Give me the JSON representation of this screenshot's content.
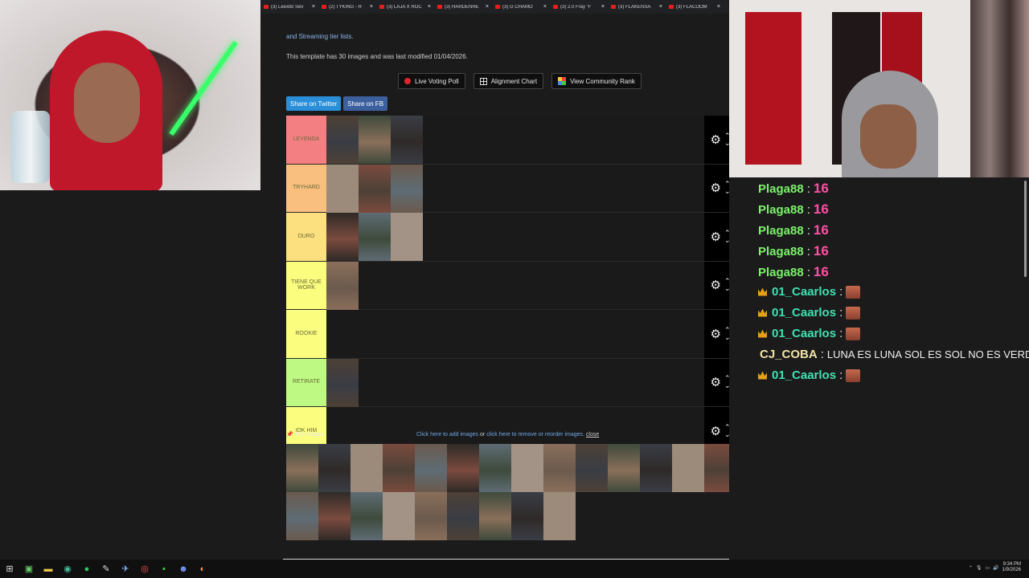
{
  "browser": {
    "tabs": [
      {
        "title": "(3) Leexito Sev",
        "close": "×"
      },
      {
        "title": "(2) TYKING - R",
        "close": "×"
      },
      {
        "title": "(3) LAJA X ROC",
        "close": "×"
      },
      {
        "title": "(3) HARDENRE",
        "close": "×"
      },
      {
        "title": "(3) G CHAMO",
        "close": "×"
      },
      {
        "title": "(3) 2.0 Fray \"F",
        "close": "×"
      },
      {
        "title": "(3) FLAKENSA",
        "close": "×"
      },
      {
        "title": "(3) FLACOOM",
        "close": "×"
      }
    ]
  },
  "page": {
    "streaming_link": "and Streaming tier lists.",
    "template_info": "This template has 30 images and was last modified 01/04/2026.",
    "buttons": {
      "live_poll": "Live Voting Poll",
      "alignment": "Alignment Chart",
      "community": "View Community Rank"
    },
    "share": {
      "twitter": "Share on Twitter",
      "facebook": "Share on FB"
    },
    "tiers": [
      {
        "label": "LEYENDA",
        "color": "#f47f82",
        "count": 3
      },
      {
        "label": "TRYHARD",
        "color": "#f8bf7f",
        "count": 3
      },
      {
        "label": "DURO",
        "color": "#fcdf7f",
        "count": 3
      },
      {
        "label": "TIENE QUE WORK",
        "color": "#fbfd7f",
        "count": 1
      },
      {
        "label": "ROOKIE",
        "color": "#fbfd7f",
        "count": 0
      },
      {
        "label": "RETIRATE",
        "color": "#bef983",
        "count": 1
      },
      {
        "label": "IDK HIM",
        "color": "#fbfd7f",
        "count": 0
      }
    ],
    "pin_label": "Pin Images",
    "pin_help": {
      "add": "Click here to add images",
      "or": "or",
      "remove": "click here to remove or reorder images.",
      "close": "close"
    },
    "pool_count": 23
  },
  "chat": {
    "messages": [
      {
        "user": "Plaga88",
        "color": "#7cf26a",
        "value": "16",
        "crown": false
      },
      {
        "user": "Plaga88",
        "color": "#7cf26a",
        "value": "16",
        "crown": false
      },
      {
        "user": "Plaga88",
        "color": "#7cf26a",
        "value": "16",
        "crown": false
      },
      {
        "user": "Plaga88",
        "color": "#7cf26a",
        "value": "16",
        "crown": false
      },
      {
        "user": "Plaga88",
        "color": "#7cf26a",
        "value": "16",
        "crown": false
      },
      {
        "user": "01_Caarlos",
        "color": "#3fe1b0",
        "emote": true,
        "crown": true
      },
      {
        "user": "01_Caarlos",
        "color": "#3fe1b0",
        "emote": true,
        "crown": true
      },
      {
        "user": "01_Caarlos",
        "color": "#3fe1b0",
        "emote": true,
        "crown": true
      },
      {
        "user": "CJ_COBA",
        "color": "#f2e3a6",
        "text": "LUNA ES LUNA SOL ES SOL NO ES VERDA",
        "crown": false
      },
      {
        "user": "01_Caarlos",
        "color": "#3fe1b0",
        "emote": true,
        "crown": true
      }
    ]
  },
  "taskbar": {
    "time": "9:34 PM",
    "date": "1/9/2026"
  }
}
